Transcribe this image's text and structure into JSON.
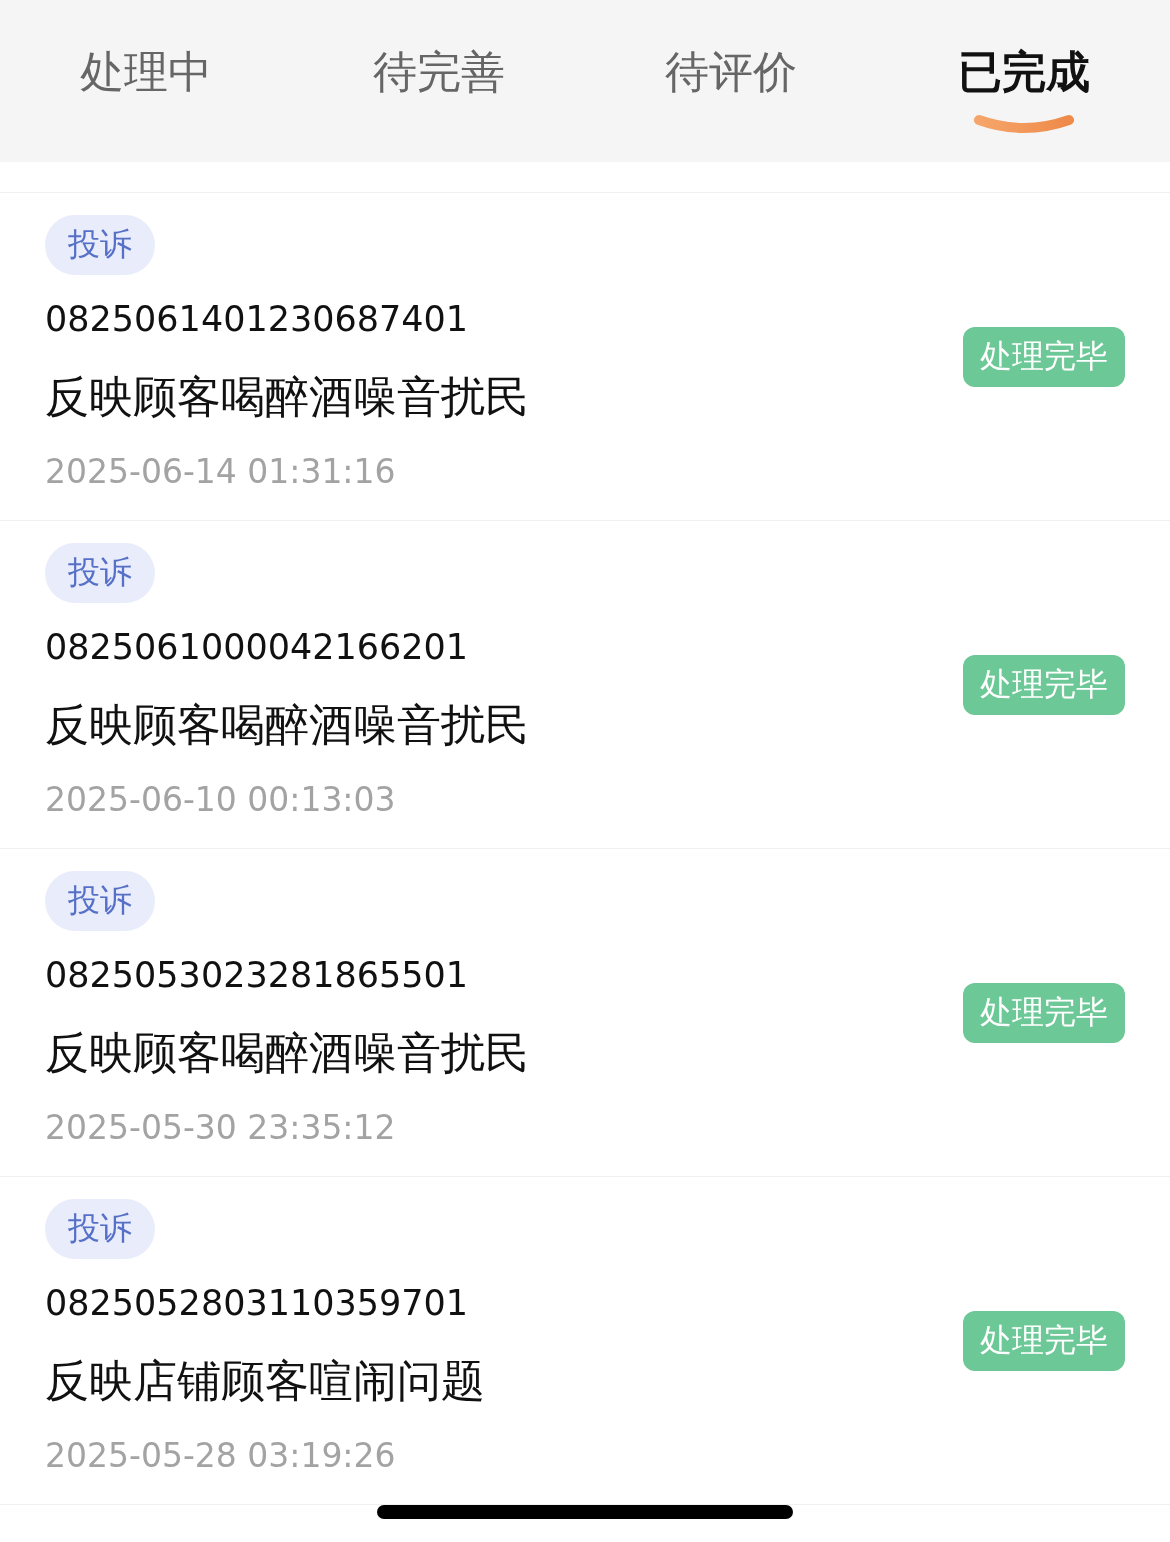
{
  "tabs": [
    {
      "label": "处理中",
      "selected": false
    },
    {
      "label": "待完善",
      "selected": false
    },
    {
      "label": "待评价",
      "selected": false
    },
    {
      "label": "已完成",
      "selected": true
    }
  ],
  "tickets": [
    {
      "tag": "投诉",
      "number": "0825061401230687401",
      "title": "反映顾客喝醉酒噪音扰民",
      "time": "2025-06-14 01:31:16",
      "status": "处理完毕"
    },
    {
      "tag": "投诉",
      "number": "0825061000042166201",
      "title": "反映顾客喝醉酒噪音扰民",
      "time": "2025-06-10 00:13:03",
      "status": "处理完毕"
    },
    {
      "tag": "投诉",
      "number": "0825053023281865501",
      "title": "反映顾客喝醉酒噪音扰民",
      "time": "2025-05-30 23:35:12",
      "status": "处理完毕"
    },
    {
      "tag": "投诉",
      "number": "0825052803110359701",
      "title": "反映店铺顾客喧闹问题",
      "time": "2025-05-28 03:19:26",
      "status": "处理完毕"
    }
  ]
}
